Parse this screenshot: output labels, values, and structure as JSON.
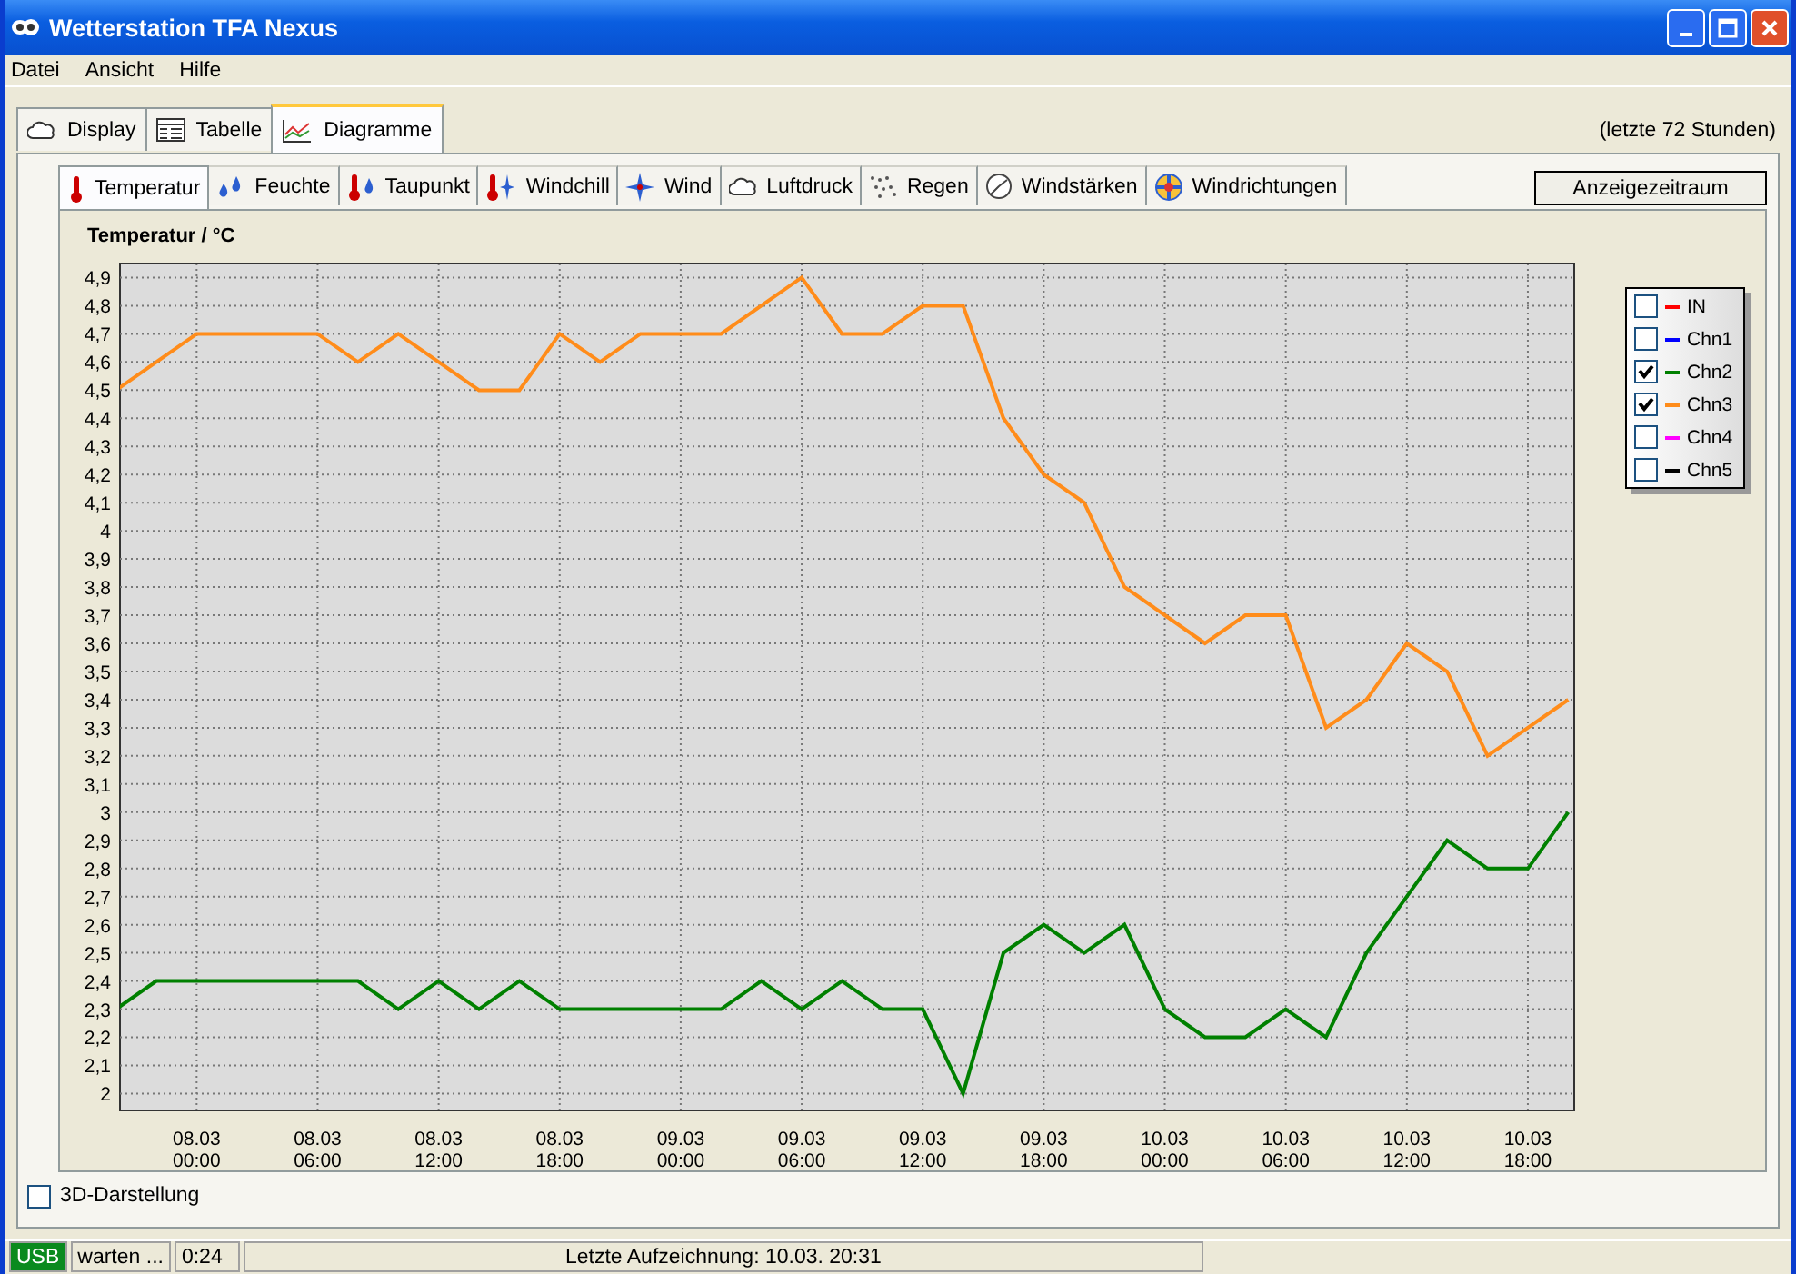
{
  "window": {
    "title": "Wetterstation TFA Nexus"
  },
  "menu": [
    "Datei",
    "Ansicht",
    "Hilfe"
  ],
  "tabs": [
    {
      "label": "Display",
      "selected": false
    },
    {
      "label": "Tabelle",
      "selected": false
    },
    {
      "label": "Diagramme",
      "selected": true
    }
  ],
  "period_note": "(letzte 72 Stunden)",
  "sub_tabs": [
    {
      "label": "Temperatur",
      "selected": true
    },
    {
      "label": "Feuchte",
      "selected": false
    },
    {
      "label": "Taupunkt",
      "selected": false
    },
    {
      "label": "Windchill",
      "selected": false
    },
    {
      "label": "Wind",
      "selected": false
    },
    {
      "label": "Luftdruck",
      "selected": false
    },
    {
      "label": "Regen",
      "selected": false
    },
    {
      "label": "Windstärken",
      "selected": false
    },
    {
      "label": "Windrichtungen",
      "selected": false
    }
  ],
  "period_button": "Anzeigezeitraum",
  "chart": {
    "chart_data": {
      "type": "line",
      "title": "Temperatur / °C",
      "categories": [
        null,
        null,
        "08.03 00:00",
        null,
        null,
        "08.03 06:00",
        null,
        null,
        "08.03 12:00",
        null,
        null,
        "08.03 18:00",
        null,
        null,
        "09.03 00:00",
        null,
        null,
        "09.03 06:00",
        null,
        null,
        "09.03 12:00",
        null,
        null,
        "09.03 18:00",
        null,
        null,
        "10.03 00:00",
        null,
        null,
        "10.03 06:00",
        null,
        null,
        "10.03 12:00",
        null,
        null,
        "10.03 18:00",
        null
      ],
      "series": [
        {
          "color": "#008000",
          "values": [
            2.3,
            2.4,
            2.4,
            2.4,
            2.4,
            2.4,
            2.4,
            2.3,
            2.4,
            2.3,
            2.4,
            2.3,
            2.3,
            2.3,
            2.3,
            2.3,
            2.4,
            2.3,
            2.4,
            2.3,
            2.3,
            2.0,
            2.5,
            2.6,
            2.5,
            2.6,
            2.3,
            2.2,
            2.2,
            2.3,
            2.2,
            2.5,
            2.7,
            2.9,
            2.8,
            2.8,
            3.0
          ]
        },
        {
          "color": "#ff8c1a",
          "values": [
            4.5,
            4.6,
            4.7,
            4.7,
            4.7,
            4.7,
            4.6,
            4.7,
            4.6,
            4.5,
            4.5,
            4.7,
            4.6,
            4.7,
            4.7,
            4.7,
            4.8,
            4.9,
            4.7,
            4.7,
            4.8,
            4.8,
            4.4,
            4.2,
            4.1,
            3.8,
            3.7,
            3.6,
            3.7,
            3.7,
            3.3,
            3.4,
            3.6,
            3.5,
            3.2,
            3.3,
            3.4
          ]
        }
      ],
      "ylim": [
        1.94,
        4.95
      ],
      "grid": true,
      "yticks": [
        {
          "value": 2,
          "label": "2"
        },
        {
          "value": 2.1,
          "label": "2,1"
        },
        {
          "value": 2.2,
          "label": "2,2"
        },
        {
          "value": 2.3,
          "label": "2,3"
        },
        {
          "value": 2.4,
          "label": "2,4"
        },
        {
          "value": 2.5,
          "label": "2,5"
        },
        {
          "value": 2.6,
          "label": "2,6"
        },
        {
          "value": 2.7,
          "label": "2,7"
        },
        {
          "value": 2.8,
          "label": "2,8"
        },
        {
          "value": 2.9,
          "label": "2,9"
        },
        {
          "value": 3,
          "label": "3"
        },
        {
          "value": 3.1,
          "label": "3,1"
        },
        {
          "value": 3.2,
          "label": "3,2"
        },
        {
          "value": 3.3,
          "label": "3,3"
        },
        {
          "value": 3.4,
          "label": "3,4"
        },
        {
          "value": 3.5,
          "label": "3,5"
        },
        {
          "value": 3.6,
          "label": "3,6"
        },
        {
          "value": 3.7,
          "label": "3,7"
        },
        {
          "value": 3.8,
          "label": "3,8"
        },
        {
          "value": 3.9,
          "label": "3,9"
        },
        {
          "value": 4,
          "label": "4"
        },
        {
          "value": 4.1,
          "label": "4,1"
        },
        {
          "value": 4.2,
          "label": "4,2"
        },
        {
          "value": 4.3,
          "label": "4,3"
        },
        {
          "value": 4.4,
          "label": "4,4"
        },
        {
          "value": 4.5,
          "label": "4,5"
        },
        {
          "value": 4.6,
          "label": "4,6"
        },
        {
          "value": 4.7,
          "label": "4,7"
        },
        {
          "value": 4.8,
          "label": "4,8"
        },
        {
          "value": 4.9,
          "label": "4,9"
        }
      ]
    },
    "legend": [
      {
        "label": "IN",
        "color": "#ff0000",
        "checked": false
      },
      {
        "label": "Chn1",
        "color": "#0000ff",
        "checked": false
      },
      {
        "label": "Chn2",
        "color": "#008000",
        "checked": true
      },
      {
        "label": "Chn3",
        "color": "#ff8c1a",
        "checked": true
      },
      {
        "label": "Chn4",
        "color": "#ff00ff",
        "checked": false
      },
      {
        "label": "Chn5",
        "color": "#000000",
        "checked": false
      }
    ]
  },
  "display_3d": {
    "label": "3D-Darstellung",
    "checked": false
  },
  "status_bar": [
    {
      "kind": "indicator",
      "text": "USB"
    },
    {
      "kind": "text",
      "text": "warten ..."
    },
    {
      "kind": "text",
      "text": "0:24"
    },
    {
      "kind": "wide",
      "text": "Letzte Aufzeichnung: 10.03. 20:31"
    }
  ]
}
